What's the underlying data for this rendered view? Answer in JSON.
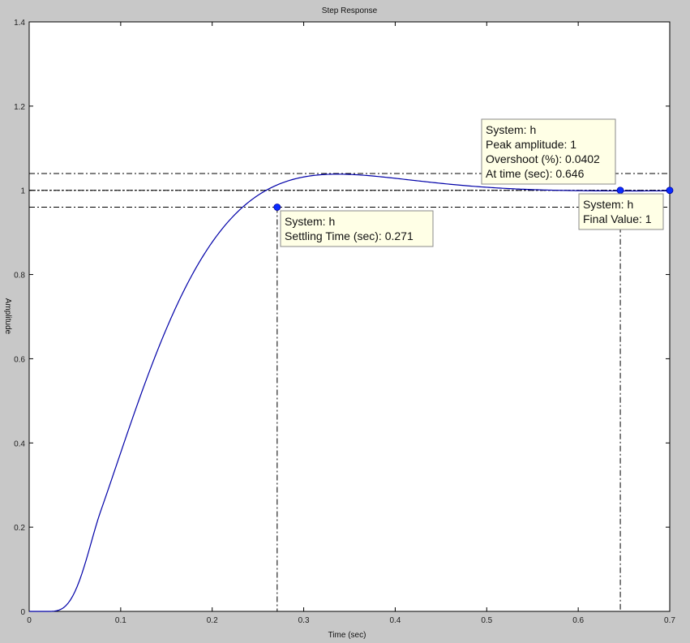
{
  "chart_data": {
    "type": "line",
    "title": "Step Response",
    "xlabel": "Time (sec)",
    "ylabel": "Amplitude",
    "xlim": [
      0,
      0.7
    ],
    "ylim": [
      0,
      1.4
    ],
    "grid": false,
    "x_ticks": [
      "0",
      "0.1",
      "0.2",
      "0.3",
      "0.4",
      "0.5",
      "0.6",
      "0.7"
    ],
    "y_ticks": [
      "0",
      "0.2",
      "0.4",
      "0.6",
      "0.8",
      "1",
      "1.2",
      "1.4"
    ],
    "series": [
      {
        "color": "#0000a8",
        "x": [
          0,
          0.01,
          0.02,
          0.03,
          0.04,
          0.05,
          0.06,
          0.07,
          0.08,
          0.09,
          0.1,
          0.11,
          0.12,
          0.13,
          0.14,
          0.15,
          0.16,
          0.17,
          0.18,
          0.19,
          0.2,
          0.21,
          0.22,
          0.23,
          0.24,
          0.25,
          0.26,
          0.27,
          0.28,
          0.29,
          0.3,
          0.31,
          0.32,
          0.33,
          0.34,
          0.35,
          0.37,
          0.4,
          0.43,
          0.46,
          0.5,
          0.55,
          0.6,
          0.646,
          0.7
        ],
        "y": [
          0,
          0,
          0.003,
          0.012,
          0.03,
          0.055,
          0.09,
          0.135,
          0.19,
          0.255,
          0.33,
          0.41,
          0.495,
          0.58,
          0.665,
          0.745,
          0.82,
          0.885,
          0.938,
          0.978,
          0.91,
          0.925,
          0.935,
          0.943,
          0.95,
          0.955,
          0.958,
          0.96,
          0.972,
          0.982,
          0.99,
          0.995,
          0.998,
          0.999,
          0.999,
          0.998,
          0.996,
          0.993,
          0.991,
          0.993,
          0.996,
          0.999,
          1.0,
          1.0004,
          1.0
        ]
      }
    ],
    "reference_lines": {
      "final_value": 1,
      "settling_band": [
        0.96,
        1.04
      ],
      "settling_time": 0.271,
      "peak_time": 0.646,
      "final_time": 0.7
    },
    "markers": [
      {
        "x": 0.271,
        "y": 0.96
      },
      {
        "x": 0.646,
        "y": 1.0
      },
      {
        "x": 0.7,
        "y": 1.0
      }
    ],
    "datatips": [
      {
        "lines": [
          "System: h",
          "Settling Time (sec): 0.271"
        ]
      },
      {
        "lines": [
          "System: h",
          "Peak amplitude: 1",
          "Overshoot (%): 0.0402",
          "At time (sec): 0.646"
        ]
      },
      {
        "lines": [
          "System: h",
          "Final Value: 1"
        ]
      }
    ]
  }
}
